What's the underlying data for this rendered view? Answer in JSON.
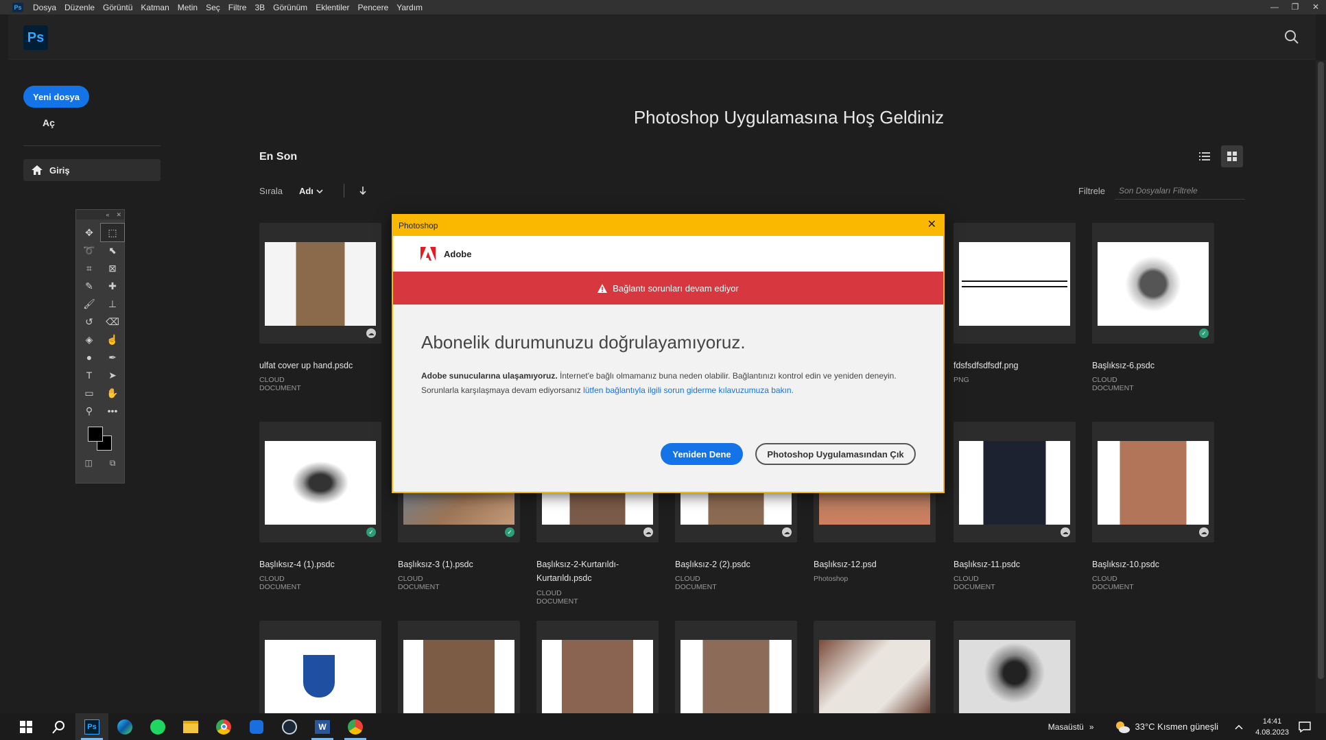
{
  "menubar": {
    "app_icon": "Ps",
    "items": [
      "Dosya",
      "Düzenle",
      "Görüntü",
      "Katman",
      "Metin",
      "Seç",
      "Filtre",
      "3B",
      "Görünüm",
      "Eklentiler",
      "Pencere",
      "Yardım"
    ],
    "minimize": "—",
    "restore": "❐",
    "close": "✕"
  },
  "topbar": {
    "logo": "Ps",
    "search_icon": "search-icon"
  },
  "sidebar": {
    "new_file": "Yeni dosya",
    "open": "Aç",
    "home": "Giriş"
  },
  "main": {
    "title": "Photoshop Uygulamasına Hoş Geldiniz",
    "recent": "En Son",
    "sort_label": "Sırala",
    "sort_value": "Adı",
    "filter_label": "Filtrele",
    "filter_placeholder": "Son Dosyaları Filtrele"
  },
  "files": [
    {
      "name": "ulfat cover up hand.psdc",
      "type": "CLOUD DOCUMENT",
      "status": "cloud"
    },
    {
      "name": "",
      "type": "",
      "status": "cloud"
    },
    {
      "name": "",
      "type": "",
      "status": "cloud"
    },
    {
      "name": "",
      "type": "",
      "status": "cloud"
    },
    {
      "name": "",
      "type": "",
      "status": "cloud"
    },
    {
      "name": "fdsfsdfsdfsdf.png",
      "type": "PNG",
      "status": "none"
    },
    {
      "name": "Başlıksız-6.psdc",
      "type": "CLOUD DOCUMENT",
      "status": "ok"
    },
    {
      "name": "Başlıksız-4 (1).psdc",
      "type": "CLOUD DOCUMENT",
      "status": "ok"
    },
    {
      "name": "Başlıksız-3 (1).psdc",
      "type": "CLOUD DOCUMENT",
      "status": "ok"
    },
    {
      "name": "Başlıksız-2-Kurtarıldı-Kurtarıldı.psdc",
      "type": "CLOUD DOCUMENT",
      "status": "cloud"
    },
    {
      "name": "Başlıksız-2 (2).psdc",
      "type": "CLOUD DOCUMENT",
      "status": "cloud"
    },
    {
      "name": "Başlıksız-12.psd",
      "type": "Photoshop",
      "status": "none"
    },
    {
      "name": "Başlıksız-11.psdc",
      "type": "CLOUD DOCUMENT",
      "status": "cloud"
    },
    {
      "name": "Başlıksız-10.psdc",
      "type": "CLOUD DOCUMENT",
      "status": "cloud"
    },
    {
      "name": "",
      "type": "",
      "status": "none"
    },
    {
      "name": "",
      "type": "",
      "status": "none"
    },
    {
      "name": "",
      "type": "",
      "status": "none"
    },
    {
      "name": "",
      "type": "",
      "status": "none"
    },
    {
      "name": "",
      "type": "",
      "status": "none"
    },
    {
      "name": "",
      "type": "",
      "status": "none"
    }
  ],
  "dialog": {
    "title": "Photoshop",
    "close": "✕",
    "brand": "Adobe",
    "banner": "Bağlantı sorunları devam ediyor",
    "heading": "Abonelik durumunuzu doğrulayamıyoruz.",
    "body_bold": "Adobe sunucularına ulaşamıyoruz.",
    "body_text": " İnternet'e bağlı olmamanız buna neden olabilir. Bağlantınızı kontrol edin ve yeniden deneyin. Sorunlarla karşılaşmaya devam ediyorsanız ",
    "body_link": "lütfen bağlantıyla ilgili sorun giderme kılavuzumuza bakın.",
    "retry": "Yeniden Dene",
    "quit": "Photoshop Uygulamasından Çık"
  },
  "taskbar": {
    "desktop": "Masaüstü",
    "chevron": "»",
    "weather": "33°C  Kısmen güneşli",
    "time": "14:41",
    "date": "4.08.2023"
  },
  "colors": {
    "accent": "#1473e6",
    "dialog_border": "#fbb800",
    "error": "#d7373f",
    "ok": "#2d9d78"
  }
}
